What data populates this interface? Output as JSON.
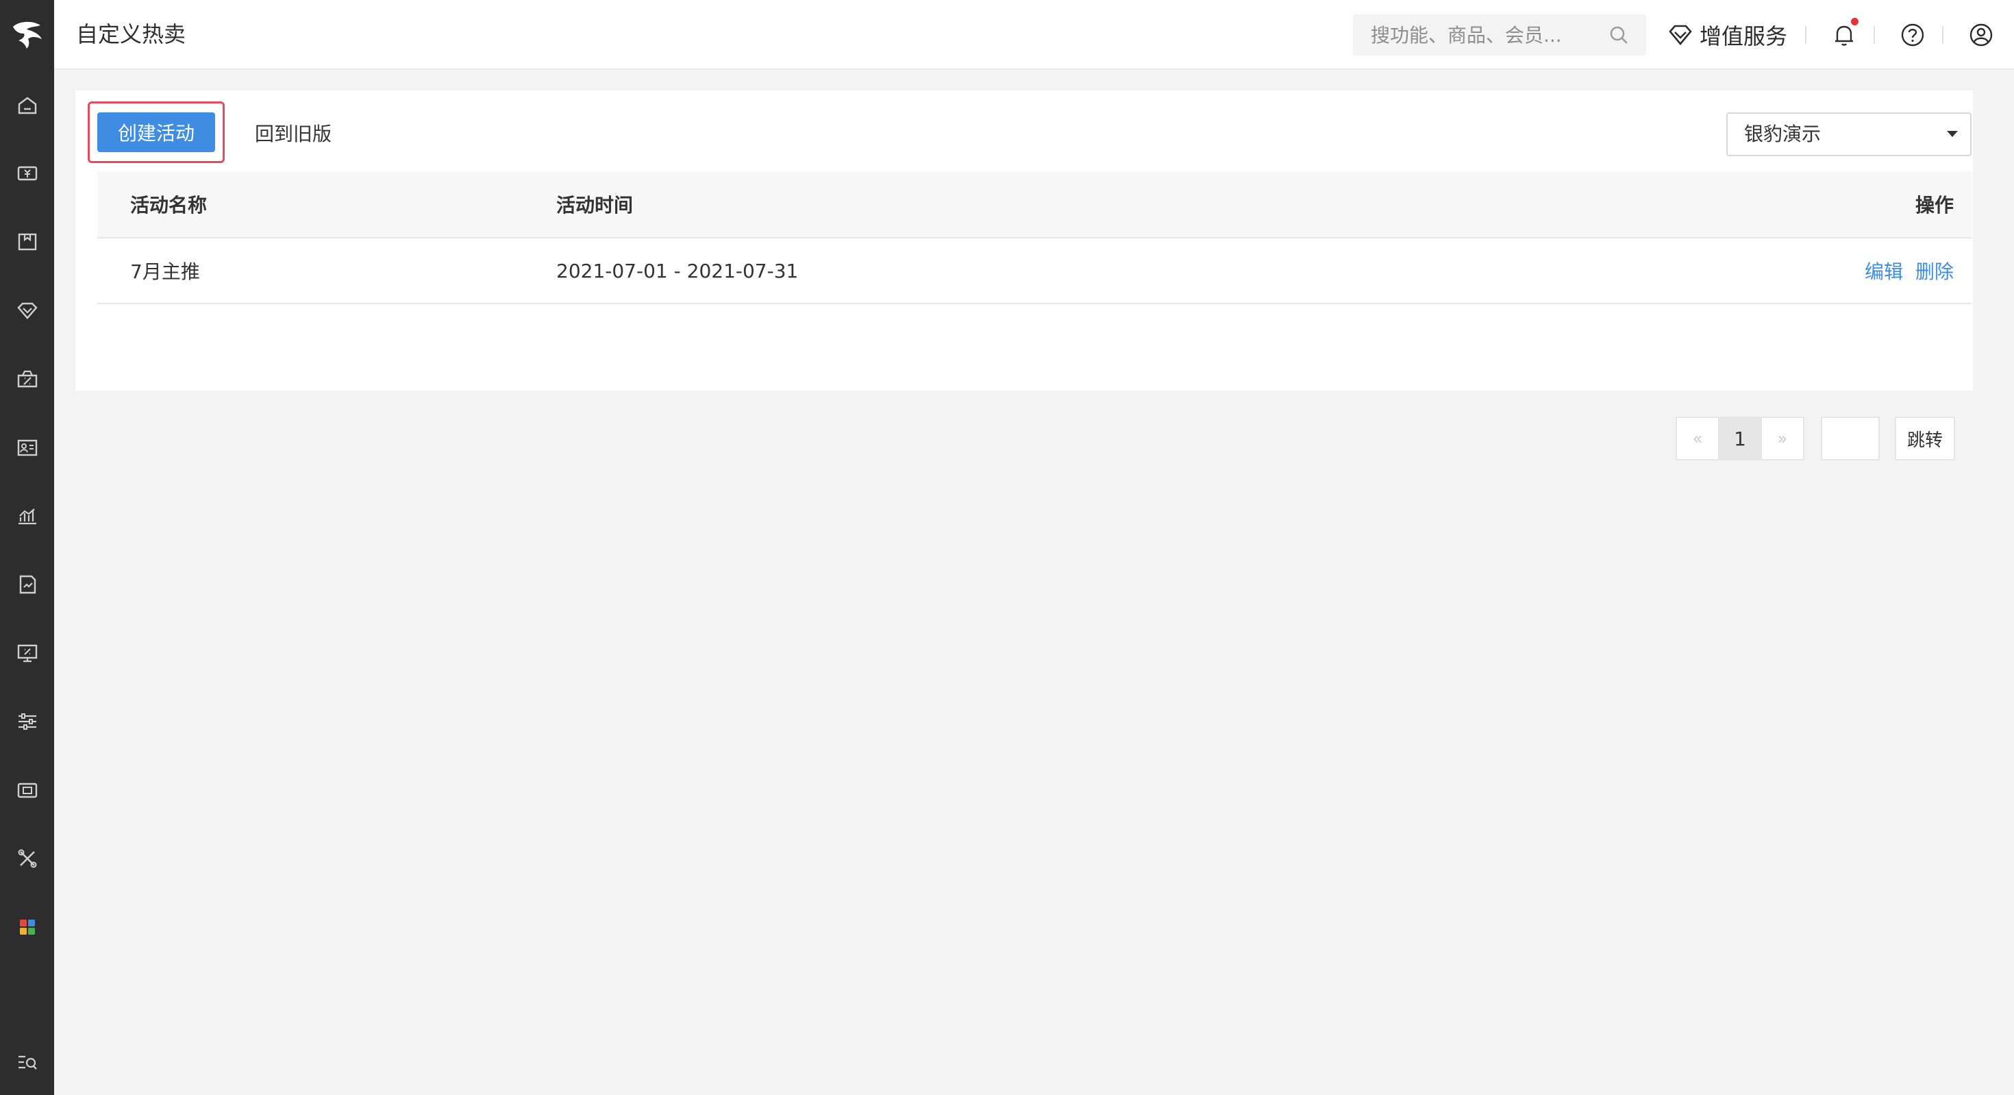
{
  "header": {
    "title": "自定义热卖",
    "search_placeholder": "搜功能、商品、会员...",
    "value_added_services": "增值服务",
    "has_notification": true
  },
  "sidebar": {
    "items": [
      {
        "icon": "home-icon"
      },
      {
        "icon": "cashier-icon"
      },
      {
        "icon": "goods-icon"
      },
      {
        "icon": "member-icon"
      },
      {
        "icon": "marketing-icon"
      },
      {
        "icon": "staff-icon"
      },
      {
        "icon": "report-icon"
      },
      {
        "icon": "finance-icon"
      },
      {
        "icon": "promotion-screen-icon"
      },
      {
        "icon": "settings-sliders-icon"
      },
      {
        "icon": "device-icon"
      },
      {
        "icon": "tools-icon"
      },
      {
        "icon": "apps-icon"
      },
      {
        "icon": "search-menu-icon"
      }
    ]
  },
  "toolbar": {
    "create_label": "创建活动",
    "old_version_label": "回到旧版",
    "store_select": "银豹演示"
  },
  "table": {
    "columns": [
      "活动名称",
      "活动时间",
      "操作"
    ],
    "rows": [
      {
        "name": "7月主推",
        "time": "2021-07-01 - 2021-07-31",
        "edit": "编辑",
        "delete": "删除"
      }
    ]
  },
  "pagination": {
    "prev": "«",
    "current": "1",
    "next": "»",
    "go_label": "跳转"
  },
  "colors": {
    "primary": "#3f8de2",
    "highlight": "#e64a5e",
    "sidebar": "#2d2d2d",
    "notification": "#e63232"
  }
}
